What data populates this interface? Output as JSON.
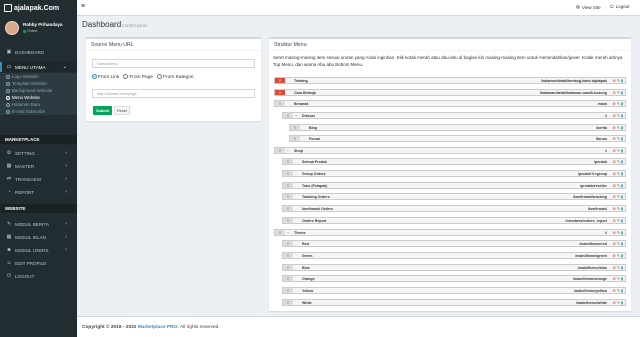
{
  "app": {
    "logo_text": "ajalapak.Com"
  },
  "user": {
    "name": "Robby Prihandaya",
    "status": "Online"
  },
  "sidebar": {
    "dashboard": "DASHBOARD",
    "menu_utama": "MENU UTAMA",
    "submenu": [
      "Logo Website",
      "Template Website",
      "Background Website",
      "Menu Website",
      "Halaman Baru",
      "E-mail Subscribe"
    ],
    "section_marketplace": "MARKETPLACE",
    "marketplace": [
      "SETTING",
      "MASTER",
      "TRANSAKSI",
      "REPORT"
    ],
    "section_website": "WEBSITE",
    "website": [
      "MODUL BERITA",
      "MODUL IKLAN",
      "MODUL USERS",
      "EDIT PROFILE",
      "LOGOUT"
    ]
  },
  "topbar": {
    "view_site": "View Site",
    "logout": "Logout"
  },
  "page": {
    "title": "Dashboard",
    "subtitle": "Control panel"
  },
  "source_box": {
    "title": "Source Menu URL",
    "name_placeholder": "Nama Menu",
    "radio_options": [
      "From Link",
      "From Page",
      "From Kategori"
    ],
    "url_placeholder": "http://domain.com/page",
    "submit_label": "Submit",
    "reset_label": "Reset"
  },
  "structure_box": {
    "title": "Struktur Menu",
    "description": "Seret masing-masing item sesuai urutan yang Anda inginkan. Klik kotak merah atau abu-abu di bagian kiri masing-masing item untuk memindahkan/geser. Kotak merah artinya Top Menu, dan warna Abu abu Bottom Menu.",
    "items": [
      {
        "label": "Tentang",
        "url": "/halaman/detail/tentang-kami-tajalapak",
        "type": "top",
        "level": 0,
        "toggle": ""
      },
      {
        "label": "Cara Belanja",
        "url": "/halaman/detail/halaman-masih-kosong",
        "type": "top",
        "level": 0,
        "toggle": ""
      },
      {
        "label": "Beranda",
        "url": "/main",
        "type": "bottom",
        "level": 0,
        "toggle": ""
      },
      {
        "label": "Diskusi",
        "url": "#",
        "type": "bottom",
        "level": 1,
        "toggle": "−"
      },
      {
        "label": "Blog",
        "url": "/berita",
        "type": "bottom",
        "level": 2,
        "toggle": ""
      },
      {
        "label": "Forum",
        "url": "/forum",
        "type": "bottom",
        "level": 2,
        "toggle": ""
      },
      {
        "label": "Shop",
        "url": "#",
        "type": "bottom",
        "level": 0,
        "toggle": "−"
      },
      {
        "label": "Semua Produk",
        "url": "/produk",
        "type": "bottom",
        "level": 1,
        "toggle": ""
      },
      {
        "label": "Group Orders",
        "url": "/produk?r=group",
        "type": "bottom",
        "level": 1,
        "toggle": ""
      },
      {
        "label": "Toko (Pelapak)",
        "url": "/produk/reseller",
        "type": "bottom",
        "level": 1,
        "toggle": ""
      },
      {
        "label": "Tracking Orders",
        "url": "/konfirmasi/tracking",
        "type": "bottom",
        "level": 1,
        "toggle": ""
      },
      {
        "label": "konfirmasi Orders",
        "url": "/konfirmasi",
        "type": "bottom",
        "level": 1,
        "toggle": ""
      },
      {
        "label": "Orders Report",
        "url": "/members/orders_report",
        "type": "bottom",
        "level": 1,
        "toggle": ""
      },
      {
        "label": "Theme",
        "url": "#",
        "type": "bottom",
        "level": 0,
        "toggle": "−"
      },
      {
        "label": "Red",
        "url": "/main/theme/red",
        "type": "bottom",
        "level": 1,
        "toggle": ""
      },
      {
        "label": "Green",
        "url": "/main/theme/green",
        "type": "bottom",
        "level": 1,
        "toggle": ""
      },
      {
        "label": "Blue",
        "url": "/main/theme/blue",
        "type": "bottom",
        "level": 1,
        "toggle": ""
      },
      {
        "label": "Orange",
        "url": "/main/theme/orange",
        "type": "bottom",
        "level": 1,
        "toggle": ""
      },
      {
        "label": "Yellow",
        "url": "/main/theme/yellow",
        "type": "bottom",
        "level": 1,
        "toggle": ""
      },
      {
        "label": "White",
        "url": "/main/theme/white",
        "type": "bottom",
        "level": 1,
        "toggle": ""
      }
    ]
  },
  "footer": {
    "copyright": "Copyright © 2016 - 2022",
    "brand": "Marketplace PRO.",
    "rights": "All rights reserved."
  },
  "colors": {
    "top_menu": "#dd4b39",
    "bottom_menu": "#dddddd",
    "accent": "#3c8dbc",
    "success": "#00a65a",
    "sidebar_bg": "#222d32"
  }
}
